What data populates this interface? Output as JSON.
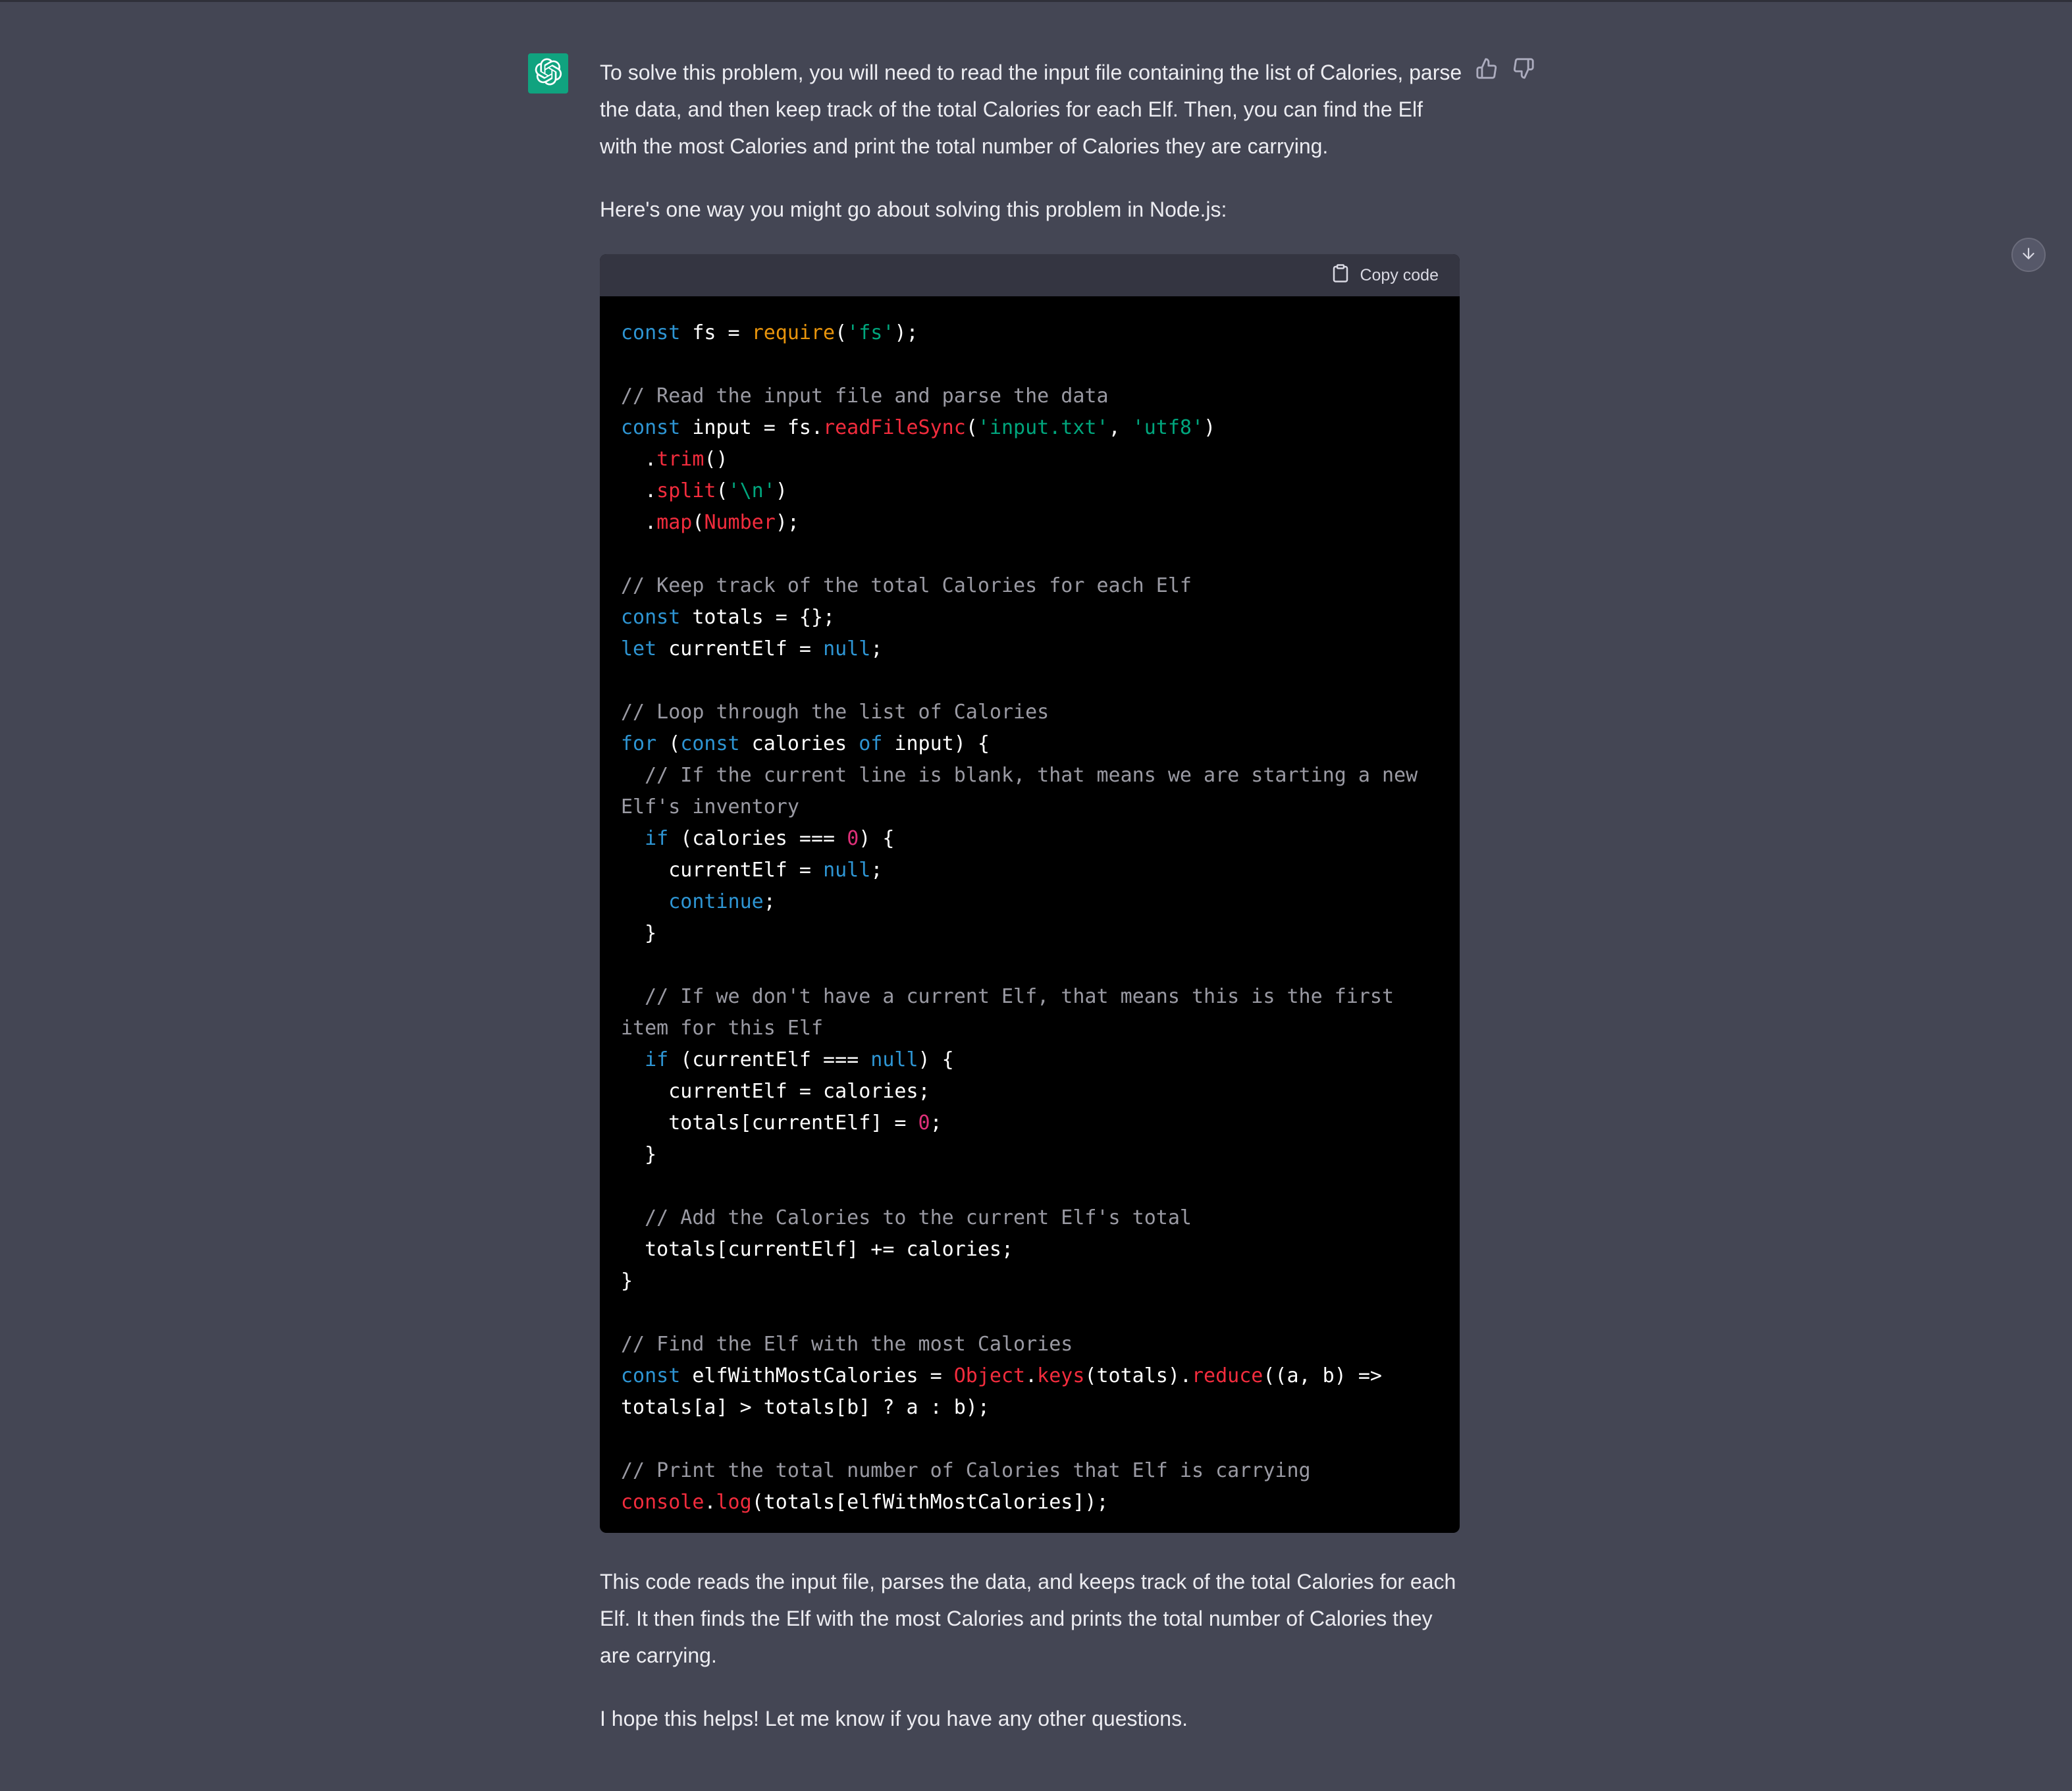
{
  "assistant": {
    "avatar_icon": "openai-logo-icon",
    "avatar_color": "#10a37f",
    "feedback": {
      "thumbs_up_icon": "thumbs-up-icon",
      "thumbs_down_icon": "thumbs-down-icon"
    },
    "scroll_button_icon": "arrow-down-icon",
    "intro_paragraphs": [
      "To solve this problem, you will need to read the input file containing the list of Calories, parse the data, and then keep track of the total Calories for each Elf. Then, you can find the Elf with the most Calories and print the total number of Calories they are carrying.",
      "Here's one way you might go about solving this problem in Node.js:"
    ],
    "code_block": {
      "copy_label": "Copy code",
      "copy_icon": "clipboard-icon",
      "lines": [
        [
          [
            "kw",
            "const"
          ],
          [
            "pl",
            " fs = "
          ],
          [
            "req",
            "require"
          ],
          [
            "pl",
            "("
          ],
          [
            "str",
            "'fs'"
          ],
          [
            "pl",
            ");"
          ]
        ],
        [],
        [
          [
            "cm",
            "// Read the input file and parse the data"
          ]
        ],
        [
          [
            "kw",
            "const"
          ],
          [
            "pl",
            " input = fs."
          ],
          [
            "fn",
            "readFileSync"
          ],
          [
            "pl",
            "("
          ],
          [
            "str",
            "'input.txt'"
          ],
          [
            "pl",
            ", "
          ],
          [
            "str",
            "'utf8'"
          ],
          [
            "pl",
            ")"
          ]
        ],
        [
          [
            "pl",
            "  ."
          ],
          [
            "fn",
            "trim"
          ],
          [
            "pl",
            "()"
          ]
        ],
        [
          [
            "pl",
            "  ."
          ],
          [
            "fn",
            "split"
          ],
          [
            "pl",
            "("
          ],
          [
            "str",
            "'\\n'"
          ],
          [
            "pl",
            ")"
          ]
        ],
        [
          [
            "pl",
            "  ."
          ],
          [
            "fn",
            "map"
          ],
          [
            "pl",
            "("
          ],
          [
            "obj",
            "Number"
          ],
          [
            "pl",
            ");"
          ]
        ],
        [],
        [
          [
            "cm",
            "// Keep track of the total Calories for each Elf"
          ]
        ],
        [
          [
            "kw",
            "const"
          ],
          [
            "pl",
            " totals = {};"
          ]
        ],
        [
          [
            "kw",
            "let"
          ],
          [
            "pl",
            " currentElf = "
          ],
          [
            "kw",
            "null"
          ],
          [
            "pl",
            ";"
          ]
        ],
        [],
        [
          [
            "cm",
            "// Loop through the list of Calories"
          ]
        ],
        [
          [
            "kw",
            "for"
          ],
          [
            "pl",
            " ("
          ],
          [
            "kw",
            "const"
          ],
          [
            "pl",
            " calories "
          ],
          [
            "kw",
            "of"
          ],
          [
            "pl",
            " input) {"
          ]
        ],
        [
          [
            "cm",
            "  // If the current line is blank, that means we are starting a new Elf's inventory"
          ]
        ],
        [
          [
            "pl",
            "  "
          ],
          [
            "kw",
            "if"
          ],
          [
            "pl",
            " (calories === "
          ],
          [
            "num",
            "0"
          ],
          [
            "pl",
            ") {"
          ]
        ],
        [
          [
            "pl",
            "    currentElf = "
          ],
          [
            "kw",
            "null"
          ],
          [
            "pl",
            ";"
          ]
        ],
        [
          [
            "pl",
            "    "
          ],
          [
            "kw",
            "continue"
          ],
          [
            "pl",
            ";"
          ]
        ],
        [
          [
            "pl",
            "  }"
          ]
        ],
        [],
        [
          [
            "cm",
            "  // If we don't have a current Elf, that means this is the first item for this Elf"
          ]
        ],
        [
          [
            "pl",
            "  "
          ],
          [
            "kw",
            "if"
          ],
          [
            "pl",
            " (currentElf === "
          ],
          [
            "kw",
            "null"
          ],
          [
            "pl",
            ") {"
          ]
        ],
        [
          [
            "pl",
            "    currentElf = calories;"
          ]
        ],
        [
          [
            "pl",
            "    totals[currentElf] = "
          ],
          [
            "num",
            "0"
          ],
          [
            "pl",
            ";"
          ]
        ],
        [
          [
            "pl",
            "  }"
          ]
        ],
        [],
        [
          [
            "cm",
            "  // Add the Calories to the current Elf's total"
          ]
        ],
        [
          [
            "pl",
            "  totals[currentElf] += calories;"
          ]
        ],
        [
          [
            "pl",
            "}"
          ]
        ],
        [],
        [
          [
            "cm",
            "// Find the Elf with the most Calories"
          ]
        ],
        [
          [
            "kw",
            "const"
          ],
          [
            "pl",
            " elfWithMostCalories = "
          ],
          [
            "obj",
            "Object"
          ],
          [
            "pl",
            "."
          ],
          [
            "fn",
            "keys"
          ],
          [
            "pl",
            "(totals)."
          ],
          [
            "fn",
            "reduce"
          ],
          [
            "pl",
            "((a, b) => totals[a] > totals[b] ? a : b);"
          ]
        ],
        [],
        [
          [
            "cm",
            "// Print the total number of Calories that Elf is carrying"
          ]
        ],
        [
          [
            "obj",
            "console"
          ],
          [
            "pl",
            "."
          ],
          [
            "fn",
            "log"
          ],
          [
            "pl",
            "(totals[elfWithMostCalories]);"
          ]
        ]
      ]
    },
    "outro_paragraphs": [
      "This code reads the input file, parses the data, and keeps track of the total Calories for each Elf. It then finds the Elf with the most Calories and prints the total number of Calories they are carrying.",
      "I hope this helps! Let me know if you have any other questions."
    ]
  }
}
